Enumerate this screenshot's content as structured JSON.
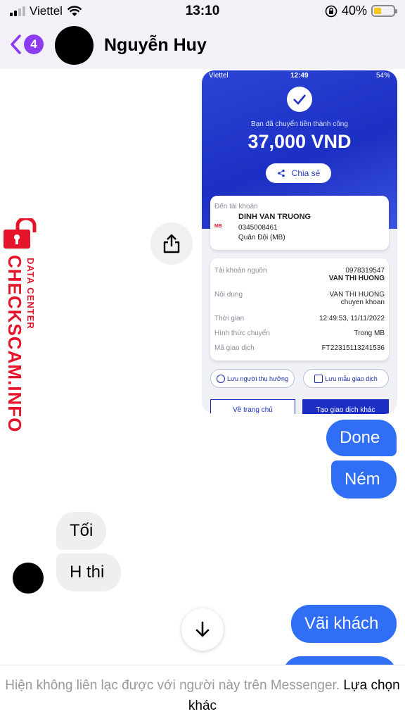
{
  "status_bar": {
    "carrier": "Viettel",
    "time": "13:10",
    "battery": "40%",
    "battery_level": 0.4
  },
  "header": {
    "unread_count": "4",
    "contact_name": "Nguyễn Huy"
  },
  "attachment": {
    "status_carrier": "Viettel",
    "status_time": "12:49",
    "status_battery": "54%",
    "success_text": "Bạn đã chuyển tiền thành công",
    "amount": "37,000 VND",
    "share_label": "Chia sẻ",
    "to_account_label": "Đến tài khoản",
    "bank_logo": "MB",
    "recipient_name": "DINH VAN TRUONG",
    "recipient_account": "0345008461",
    "recipient_bank": "Quân Đội (MB)",
    "details": [
      {
        "label": "Tài khoản nguồn",
        "value": "0978319547",
        "value2": "VAN THI HUONG"
      },
      {
        "label": "Nội dung",
        "value": "VAN THI HUONG",
        "value2": "chuyen khoan"
      },
      {
        "label": "Thời gian",
        "value": "12:49:53, 11/11/2022",
        "value2": ""
      },
      {
        "label": "Hình thức chuyển",
        "value": "Trong MB",
        "value2": ""
      },
      {
        "label": "Mã giao dịch",
        "value": "FT22315113241536",
        "value2": ""
      }
    ],
    "save_beneficiary": "Lưu người thụ hưởng",
    "save_template": "Lưu mẫu giao dịch",
    "home_button": "Về trang chủ",
    "new_transaction_button": "Tạo giao dịch khác"
  },
  "watermark": {
    "brand": "CHECKSCAM.INFO",
    "sub": "DATA CENTER"
  },
  "messages": [
    {
      "sender": "me",
      "text": "Done"
    },
    {
      "sender": "me",
      "text": "Ném"
    },
    {
      "sender": "them",
      "text": "Tối"
    },
    {
      "sender": "them",
      "text": "H thi"
    },
    {
      "sender": "me",
      "text": "Vãi khách"
    }
  ],
  "footer": {
    "notice": "Hiện không liên lạc được với người này trên Messenger.",
    "link": "Lựa chọn khác"
  },
  "colors": {
    "outgoing_bubble": "#2f6ef5",
    "incoming_bubble": "#efefef",
    "accent": "#8c3bf0",
    "mb_blue": "#1c2fc4",
    "watermark_red": "#e4152b"
  }
}
